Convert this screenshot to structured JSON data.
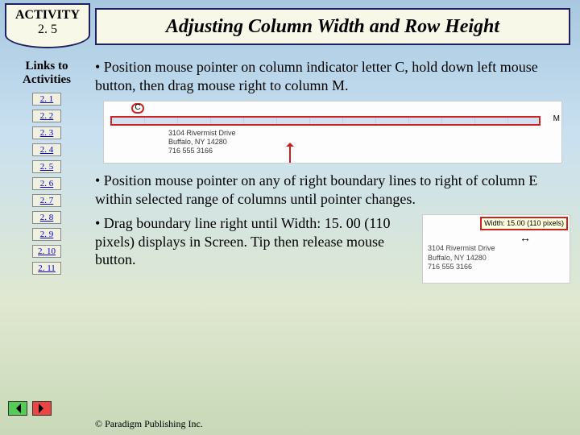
{
  "badge": {
    "line1": "ACTIVITY",
    "line2": "2. 5"
  },
  "title": "Adjusting Column Width and Row Height",
  "sidebar": {
    "heading1": "Links to",
    "heading2": "Activities",
    "links": [
      "2. 1",
      "2. 2",
      "2. 3",
      "2. 4",
      "2. 5",
      "2. 6",
      "2. 7",
      "2. 8",
      "2. 9",
      "2. 10",
      "2. 11"
    ]
  },
  "bullets": {
    "b1": "• Position mouse pointer on column indicator letter C, hold down left mouse button, then drag mouse right to column M.",
    "b2": "• Position mouse pointer on any of right boundary lines to right of column E within selected range of columns until pointer changes.",
    "b3": "• Drag boundary line right until Width: 15. 00 (110 pixels) displays in Screen. Tip then release mouse button."
  },
  "fig1": {
    "c_label": "C",
    "m_label": "M",
    "sample_line1": "3104 Rivermist Drive",
    "sample_line2": "Buffalo, NY 14280",
    "sample_line3": "716 555 3166"
  },
  "fig2": {
    "tooltip": "Width: 15.00 (110 pixels)",
    "cursor": "↔",
    "sample_line1": "3104 Rivermist Drive",
    "sample_line2": "Buffalo, NY 14280",
    "sample_line3": "716 555 3166"
  },
  "copyright": "© Paradigm Publishing Inc."
}
